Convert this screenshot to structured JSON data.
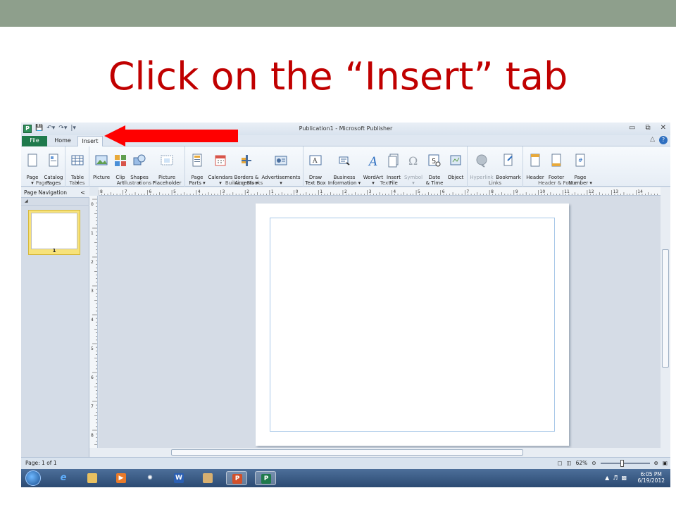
{
  "slide": {
    "title": "Click on the “Insert” tab"
  },
  "window": {
    "title": "Publication1  -  Microsoft Publisher",
    "app_icon_letter": "P"
  },
  "tabs": {
    "file": "File",
    "home": "Home",
    "insert": "Insert"
  },
  "ribbon": {
    "groups": {
      "pages": {
        "label": "Pages",
        "buttons": [
          "Page\n▾",
          "Catalog\nPages"
        ]
      },
      "tables": {
        "label": "Tables",
        "buttons": [
          "Table\n▾"
        ]
      },
      "illustrations": {
        "label": "Illustrations",
        "buttons": [
          "Picture",
          "Clip\nArt",
          "Shapes\n▾",
          "Picture\nPlaceholder"
        ]
      },
      "building_blocks": {
        "label": "Building Blocks",
        "buttons": [
          "Page\nParts ▾",
          "Calendars\n▾",
          "Borders &\nAccents ▾",
          "Advertisements\n▾"
        ]
      },
      "text": {
        "label": "Text",
        "buttons": [
          "Draw\nText Box",
          "Business\nInformation ▾",
          "WordArt\n▾",
          "Insert\nFile",
          "Symbol\n▾",
          "Date\n& Time",
          "Object"
        ]
      },
      "links": {
        "label": "Links",
        "buttons": [
          "Hyperlink",
          "Bookmark"
        ]
      },
      "header_footer": {
        "label": "Header & Footer",
        "buttons": [
          "Header",
          "Footer",
          "Page\nNumber ▾"
        ]
      }
    }
  },
  "nav_pane": {
    "title": "Page Navigation",
    "thumbnail_number": "1"
  },
  "ruler": {
    "h_labels": [
      "8",
      "7",
      "6",
      "5",
      "4",
      "3",
      "2",
      "1",
      "0",
      "1",
      "2",
      "3",
      "4",
      "5",
      "6",
      "7",
      "8",
      "9",
      "10",
      "11",
      "12",
      "13",
      "14"
    ],
    "v_labels": [
      "0",
      "1",
      "2",
      "3",
      "4",
      "5",
      "6",
      "7",
      "8"
    ]
  },
  "status": {
    "page": "Page: 1 of 1",
    "zoom": "62%"
  },
  "taskbar": {
    "time": "6:05 PM",
    "date": "6/19/2012"
  },
  "colors": {
    "title_red": "#c00000",
    "file_tab_green": "#1f7a4c",
    "arrow_red": "#ff0000"
  }
}
